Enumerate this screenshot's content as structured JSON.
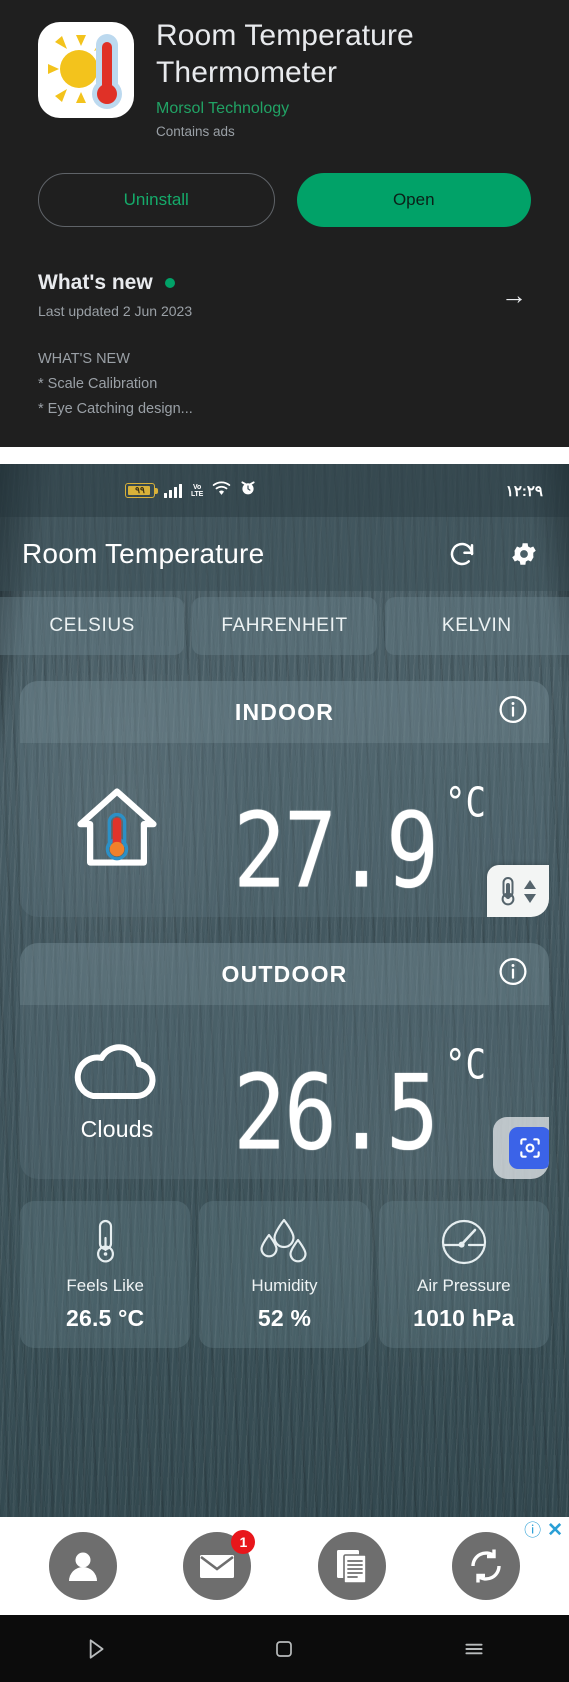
{
  "store": {
    "app_title": "Room Temperature Thermometer",
    "developer": "Morsol Technology",
    "ads_note": "Contains ads",
    "uninstall_label": "Uninstall",
    "open_label": "Open",
    "whats_new_title": "What's new",
    "last_updated": "Last updated 2 Jun 2023",
    "arrow_glyph": "→",
    "notes": [
      "WHAT'S NEW",
      "* Scale Calibration",
      "* Eye Catching design..."
    ],
    "accent_green": "#01a268",
    "dev_green": "#21a365"
  },
  "app": {
    "statusbar": {
      "battery_level": "٩٩",
      "network": "VoLTE",
      "time": "١٢:٢٩"
    },
    "appbar": {
      "title": "Room Temperature",
      "refresh_icon": "refresh-icon",
      "settings_icon": "gear-icon"
    },
    "tabs": [
      {
        "label": "CELSIUS",
        "selected": true
      },
      {
        "label": "FAHRENHEIT",
        "selected": false
      },
      {
        "label": "KELVIN",
        "selected": false
      }
    ],
    "indoor": {
      "title": "INDOOR",
      "value": "27.9",
      "unit": "°C",
      "icon": "house-thermometer-icon",
      "info_icon": "info-icon",
      "calibrate_icon": "thermometer-calibrate-icon"
    },
    "outdoor": {
      "title": "OUTDOOR",
      "value": "26.5",
      "unit": "°C",
      "condition": "Clouds",
      "icon": "cloud-icon",
      "info_icon": "info-icon",
      "scan_icon": "scan-icon"
    },
    "metrics": [
      {
        "label": "Feels Like",
        "value": "26.5 °C",
        "icon": "thermometer-icon"
      },
      {
        "label": "Humidity",
        "value": "52 %",
        "icon": "water-drops-icon"
      },
      {
        "label": "Air Pressure",
        "value": "1010 hPa",
        "icon": "gauge-icon"
      }
    ],
    "adbar": {
      "items": [
        {
          "icon": "person-icon",
          "badge": null
        },
        {
          "icon": "envelope-icon",
          "badge": "1"
        },
        {
          "icon": "documents-icon",
          "badge": null
        },
        {
          "icon": "sync-icon",
          "badge": null
        }
      ],
      "info_glyph": "ⓘ",
      "close_glyph": "✕",
      "link_color": "#2a9fd6"
    }
  },
  "navbar": {
    "back_icon": "back-triangle-icon",
    "home_icon": "home-square-icon",
    "recents_icon": "recents-icon"
  }
}
